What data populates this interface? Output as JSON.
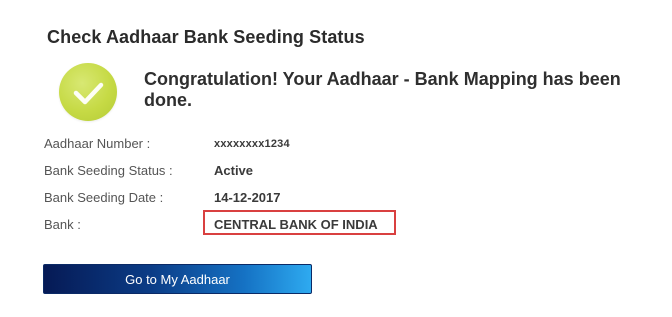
{
  "page_title": "Check Aadhaar Bank Seeding Status",
  "status_icon": "check-circle-icon",
  "status_message": "Congratulation! Your Aadhaar - Bank Mapping has been done.",
  "details": [
    {
      "label": "Aadhaar Number :",
      "value": "xxxxxxxx1234"
    },
    {
      "label": "Bank Seeding Status :",
      "value": "Active"
    },
    {
      "label": "Bank Seeding Date :",
      "value": "14-12-2017"
    },
    {
      "label": "Bank :",
      "value": "CENTRAL BANK OF INDIA"
    }
  ],
  "actions": {
    "go_to_my_aadhaar_label": "Go to My Aadhaar"
  },
  "colors": {
    "success_icon": "#c6da45",
    "highlight_border": "#d94040",
    "button_start": "#061a55",
    "button_end": "#2eaaf0"
  }
}
